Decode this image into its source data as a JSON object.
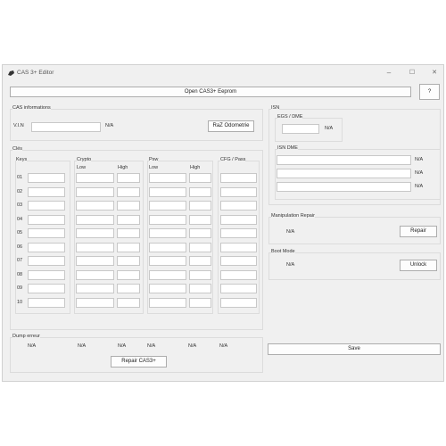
{
  "window": {
    "title": "CAS 3+ Editor",
    "minimize": "–",
    "maximize": "☐",
    "close": "✕"
  },
  "toolbar": {
    "open_label": "Open CAS3+ Eeprom",
    "help_label": "?"
  },
  "cas_info": {
    "title": "CAS informations",
    "vin_label": "V.I.N",
    "vin_value": "",
    "vin_status": "N/A",
    "raz_label": "RaZ Odometrie"
  },
  "cles": {
    "title": "Clés",
    "keys_header": "Keys",
    "crypto_header": "Crypto",
    "psw_header": "Psw",
    "cfg_header": "CFG / Pass",
    "low": "Low",
    "high": "High",
    "rows": [
      "01",
      "02",
      "03",
      "04",
      "05",
      "06",
      "07",
      "08",
      "09",
      "10"
    ]
  },
  "isn": {
    "title": "ISN",
    "egs_title": "EGS / DME",
    "egs_value": "N/A",
    "dme_title": "ISN DME",
    "dme_values": [
      "N/A",
      "N/A",
      "N/A"
    ]
  },
  "manipulation": {
    "title": "Manipulation Repair",
    "value": "N/A",
    "button": "Repair"
  },
  "boot": {
    "title": "Boot Mode",
    "value": "N/A",
    "button": "Unlock"
  },
  "dump": {
    "title": "Dump erreur",
    "values": [
      "N/A",
      "N/A",
      "N/A",
      "N/A",
      "N/A",
      "N/A"
    ],
    "button": "Repair CAS3+"
  },
  "save_label": "Save"
}
